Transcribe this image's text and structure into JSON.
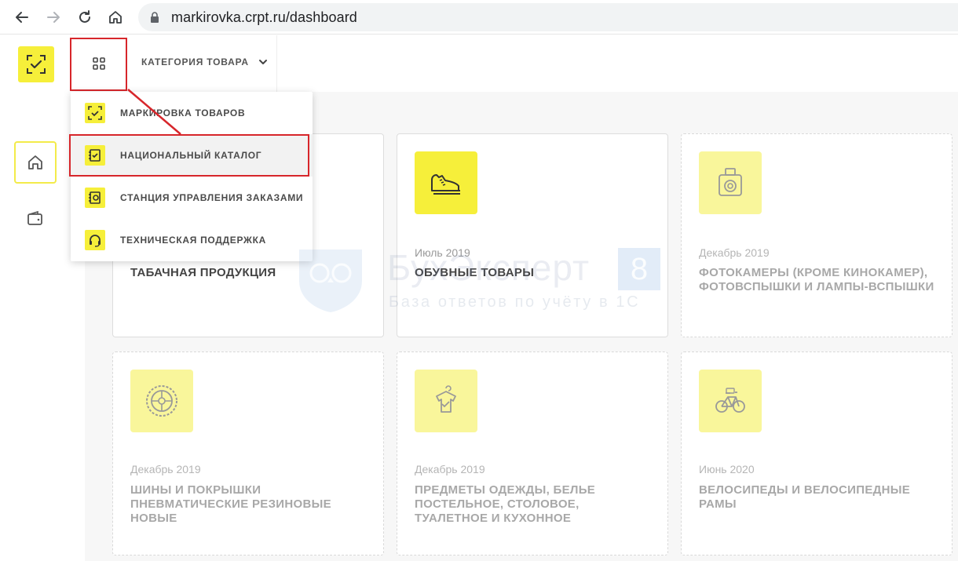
{
  "browser": {
    "url": "markirovka.crpt.ru/dashboard"
  },
  "topbar": {
    "category_label": "КАТЕГОРИЯ ТОВАРА"
  },
  "dropdown": {
    "items": [
      {
        "label": "МАРКИРОВКА ТОВАРОВ",
        "icon": "check-frame-icon"
      },
      {
        "label": "НАЦИОНАЛЬНЫЙ КАТАЛОГ",
        "icon": "catalog-check-icon"
      },
      {
        "label": "СТАНЦИЯ УПРАВЛЕНИЯ ЗАКАЗАМИ",
        "icon": "station-gear-icon"
      },
      {
        "label": "ТЕХНИЧЕСКАЯ ПОДДЕРЖКА",
        "icon": "headset-icon"
      }
    ]
  },
  "cards": [
    {
      "date": "",
      "title": "ТАБАЧНАЯ ПРОДУКЦИЯ",
      "icon": "tobacco-icon",
      "active": true
    },
    {
      "date": "Июль 2019",
      "title": "ОБУВНЫЕ ТОВАРЫ",
      "icon": "sneaker-icon",
      "active": true
    },
    {
      "date": "Декабрь 2019",
      "title": "ФОТОКАМЕРЫ (КРОМЕ КИНОКАМЕР), ФОТОВСПЫШКИ И ЛАМПЫ-ВСПЫШКИ",
      "icon": "camera-icon",
      "active": false
    },
    {
      "date": "Декабрь 2019",
      "title": "ШИНЫ И ПОКРЫШКИ ПНЕВМАТИЧЕСКИЕ РЕЗИНОВЫЕ НОВЫЕ",
      "icon": "tire-icon",
      "active": false
    },
    {
      "date": "Декабрь 2019",
      "title": "ПРЕДМЕТЫ ОДЕЖДЫ, БЕЛЬЕ ПОСТЕЛЬНОЕ, СТОЛОВОЕ, ТУАЛЕТНОЕ И КУХОННОЕ",
      "icon": "shirt-icon",
      "active": false
    },
    {
      "date": "Июнь 2020",
      "title": "ВЕЛОСИПЕДЫ И ВЕЛОСИПЕДНЫЕ РАМЫ",
      "icon": "bicycle-icon",
      "active": false
    }
  ],
  "watermark": {
    "brand": "БухЭксперт",
    "badge": "8",
    "tagline": "База ответов по учёту в 1С"
  },
  "colors": {
    "accent": "#f6ef3a",
    "accent_muted": "#f9f69b",
    "highlight": "#d7262b"
  }
}
